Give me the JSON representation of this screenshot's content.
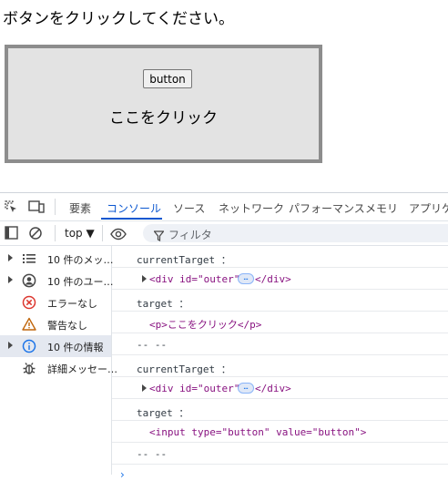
{
  "page": {
    "instruction": "ボタンをクリックしてください。",
    "button_value": "button",
    "p_text": "ここをクリック"
  },
  "devtools": {
    "tabs": [
      "要素",
      "コンソール",
      "ソース",
      "ネットワーク",
      "パフォーマンス",
      "メモリ",
      "アプリケー"
    ],
    "active_tab": "コンソール",
    "context": "top ▼",
    "filter_placeholder": "フィルタ",
    "sidebar": [
      {
        "label": "10 件のメッ…",
        "icon": "list-icon",
        "expandable": true
      },
      {
        "label": "10 件のユー…",
        "icon": "user-icon",
        "expandable": true
      },
      {
        "label": "エラーなし",
        "icon": "error-icon",
        "expandable": false
      },
      {
        "label": "警告なし",
        "icon": "warning-icon",
        "expandable": false
      },
      {
        "label": "10 件の情報",
        "icon": "info-icon",
        "expandable": true,
        "selected": true
      },
      {
        "label": "詳細メッセー…",
        "icon": "bug-icon",
        "expandable": false
      }
    ],
    "console": {
      "m1_label": "currentTarget ：",
      "m2_open": "<div id=\"outer\">",
      "m2_ellipsis": "…",
      "m2_close": "</div>",
      "m3_label": "target ：",
      "m4_p": "<p>ここをクリック</p>",
      "m5_sep": "-- --",
      "m6_label": "currentTarget ：",
      "m7_open": "<div id=\"outer\">",
      "m7_ellipsis": "…",
      "m7_close": "</div>",
      "m8_label": "target ：",
      "m9_input": "<input type=\"button\" value=\"button\">",
      "m10_sep": "-- --",
      "prompt": "›"
    }
  }
}
